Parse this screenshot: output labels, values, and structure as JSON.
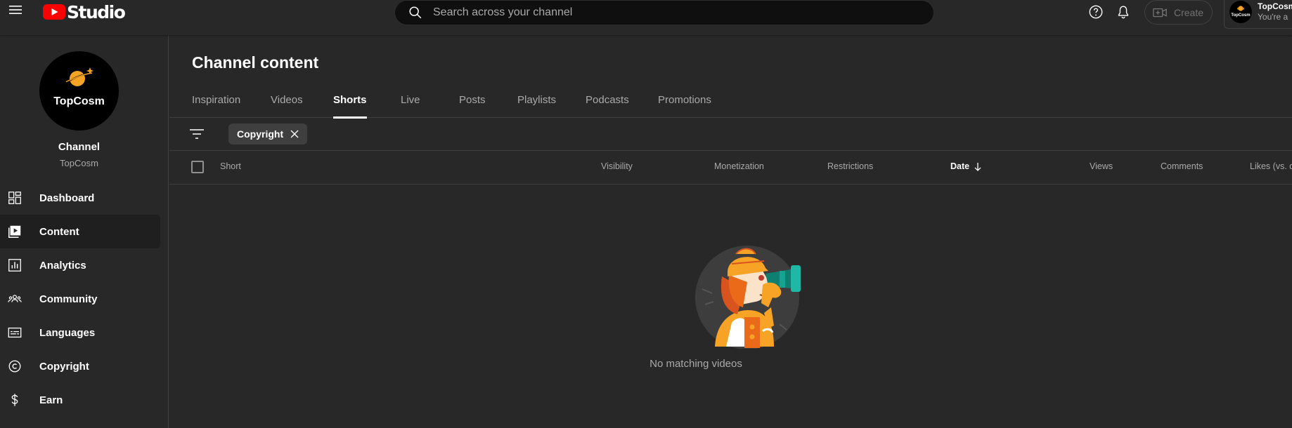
{
  "header": {
    "brand": "Studio",
    "search_placeholder": "Search across your channel",
    "create_label": "Create",
    "account": {
      "name": "TopCosm",
      "subtitle": "You're a",
      "avatar_text": "TopCosm"
    }
  },
  "sidebar": {
    "avatar_text": "TopCosm",
    "channel_title": "Channel",
    "channel_name": "TopCosm",
    "items": [
      {
        "label": "Dashboard",
        "icon": "dashboard-icon",
        "active": false
      },
      {
        "label": "Content",
        "icon": "content-icon",
        "active": true
      },
      {
        "label": "Analytics",
        "icon": "analytics-icon",
        "active": false
      },
      {
        "label": "Community",
        "icon": "community-icon",
        "active": false
      },
      {
        "label": "Languages",
        "icon": "subtitles-icon",
        "active": false
      },
      {
        "label": "Copyright",
        "icon": "copyright-icon",
        "active": false
      },
      {
        "label": "Earn",
        "icon": "dollar-icon",
        "active": false
      }
    ]
  },
  "main": {
    "title": "Channel content",
    "tabs": [
      {
        "label": "Inspiration",
        "active": false
      },
      {
        "label": "Videos",
        "active": false
      },
      {
        "label": "Shorts",
        "active": true
      },
      {
        "label": "Live",
        "active": false
      },
      {
        "label": "Posts",
        "active": false
      },
      {
        "label": "Playlists",
        "active": false
      },
      {
        "label": "Podcasts",
        "active": false
      },
      {
        "label": "Promotions",
        "active": false
      }
    ],
    "filter_chip": "Copyright",
    "columns": [
      "Short",
      "Visibility",
      "Monetization",
      "Restrictions",
      "Date",
      "Views",
      "Comments",
      "Likes (vs. d"
    ],
    "sorted_column": "Date",
    "sort_direction": "descending",
    "empty_message": "No matching videos"
  },
  "colors": {
    "background": "#282828",
    "search_bg": "#0f0f0f",
    "brand_red": "#ff0000",
    "accent_orange": "#f7a325"
  }
}
